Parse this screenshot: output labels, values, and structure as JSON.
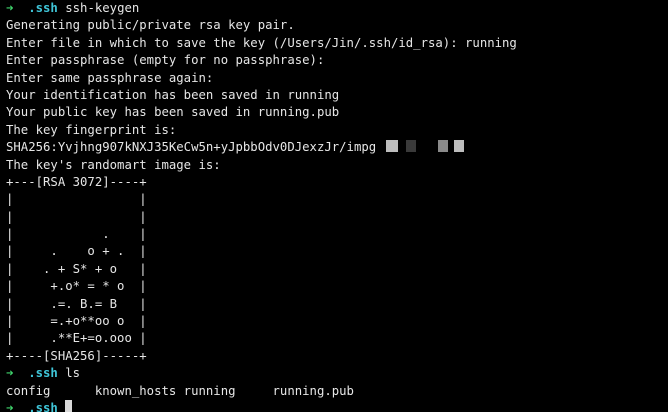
{
  "prompt": {
    "arrow": "➜",
    "dir": ".ssh"
  },
  "session": [
    {
      "type": "command",
      "cmd": "ssh-keygen"
    },
    {
      "type": "output",
      "text": "Generating public/private rsa key pair."
    },
    {
      "type": "output",
      "text": "Enter file in which to save the key (/Users/Jin/.ssh/id_rsa): running"
    },
    {
      "type": "output",
      "text": "Enter passphrase (empty for no passphrase):"
    },
    {
      "type": "output",
      "text": "Enter same passphrase again:"
    },
    {
      "type": "output",
      "text": "Your identification has been saved in running"
    },
    {
      "type": "output",
      "text": "Your public key has been saved in running.pub"
    },
    {
      "type": "output",
      "text": "The key fingerprint is:"
    },
    {
      "type": "fingerprint",
      "text": "SHA256:Yvjhng907kNXJ35KeCw5n+yJpbbOdv0DJexzJr/impg"
    },
    {
      "type": "output",
      "text": "The key's randomart image is:"
    },
    {
      "type": "art",
      "text": "+---[RSA 3072]----+"
    },
    {
      "type": "art",
      "text": "|                 |"
    },
    {
      "type": "art",
      "text": "|                 |"
    },
    {
      "type": "art",
      "text": "|            .    |"
    },
    {
      "type": "art",
      "text": "|     .    o + .  |"
    },
    {
      "type": "art",
      "text": "|    . + S* + o   |"
    },
    {
      "type": "art",
      "text": "|     +.o* = * o  |"
    },
    {
      "type": "art",
      "text": "|     .=. B.= B   |"
    },
    {
      "type": "art",
      "text": "|     =.+o**oo o  |"
    },
    {
      "type": "art",
      "text": "|     .**E+=o.ooo |"
    },
    {
      "type": "art",
      "text": "+----[SHA256]-----+"
    },
    {
      "type": "command",
      "cmd": "ls"
    },
    {
      "type": "output",
      "text": "config      known_hosts running     running.pub"
    },
    {
      "type": "input"
    }
  ],
  "colors": {
    "background": "#000000",
    "text": "#e6e6e6",
    "arrow": "#3fd26b",
    "dir": "#3fc5d8",
    "cursor": "#d9d9d9",
    "redaction_light": "#bdbdbd",
    "redaction_mid": "#8a8a8a",
    "redaction_dark": "#3a3a3a"
  }
}
